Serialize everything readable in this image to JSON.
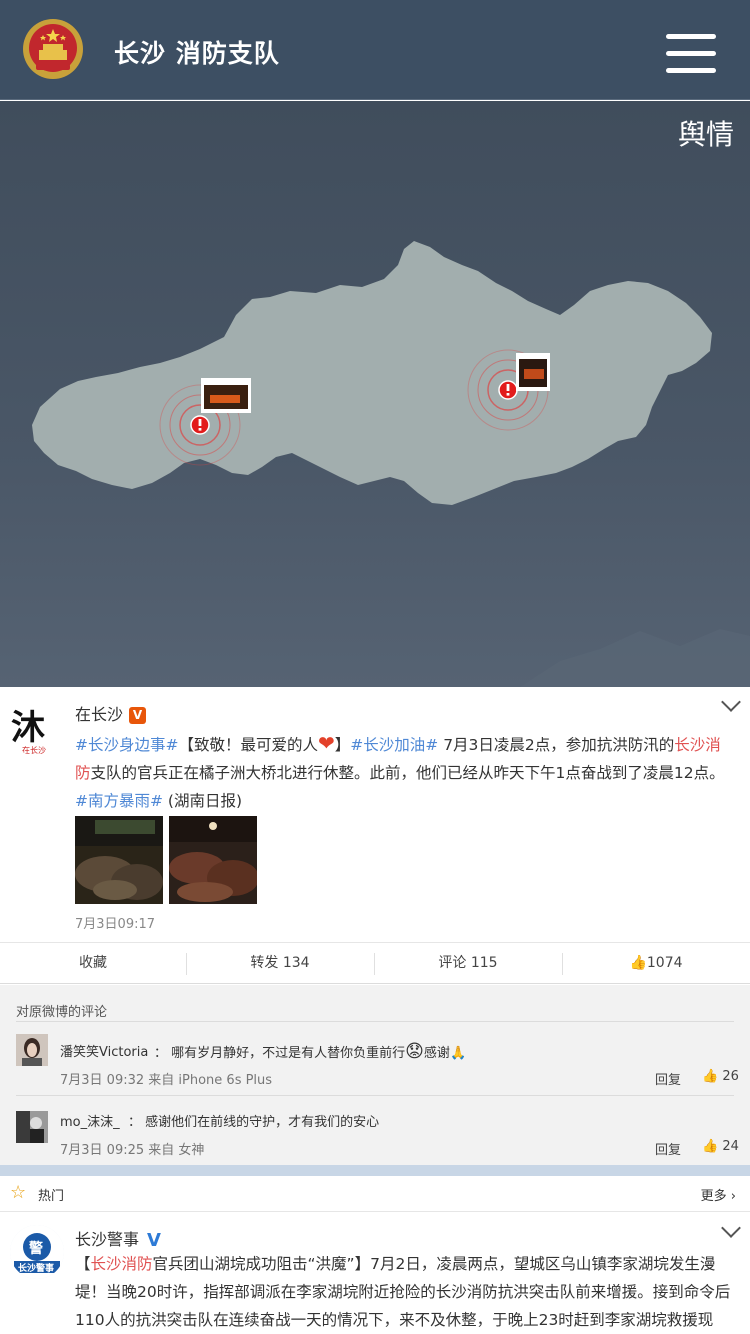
{
  "header": {
    "title": "长沙 消防支队",
    "bg_color": "#3d4f63"
  },
  "map": {
    "label": "舆情",
    "land_color": "#a2aeae"
  },
  "post1": {
    "user": "在长沙",
    "avatar_text": "沐",
    "tag1": "#长沙身边事#",
    "text1": "【致敬！最可爱的人",
    "text2": "】",
    "tag2": "#长沙加油#",
    "text3": " 7月3日凌晨2点，参加抗洪防汛的",
    "red1": "长沙消防",
    "text4": "支队的官兵正在橘子洲大桥北进行休整。此前，他们已经从昨天下午1点奋战到了凌晨12点。",
    "tag3": "#南方暴雨#",
    "text5": " (湖南日报)",
    "time": "7月3日09:17"
  },
  "actions": {
    "collect": "收藏",
    "repost": "转发 134",
    "comment": "评论 115",
    "like": "1074"
  },
  "comments": {
    "header": "对原微博的评论",
    "items": [
      {
        "user": "潘笑笑Victoria",
        "text": "哪有岁月静好，不过是有人替你负重前行",
        "text_after": "感谢",
        "meta": "7月3日 09:32 来自 iPhone 6s Plus",
        "reply": "回复",
        "likes": "26"
      },
      {
        "user": "mo_沫沫_",
        "text": "感谢他们在前线的守护，才有我们的安心",
        "meta": "7月3日 09:25 来自 女神",
        "reply": "回复",
        "likes": "24"
      }
    ]
  },
  "hot": {
    "label": "热门",
    "more": "更多"
  },
  "post2": {
    "user": "长沙警事",
    "red1": "长沙消防",
    "text1": "官兵团山湖垸成功阻击“洪魔”】7月2日，凌晨两点，望城区乌山镇李家湖垸发生漫堤！当晚20时许，指挥部调派在李家湖垸附近抢险的长沙消防抗洪突击队前来增援。接到命令后110人的抗洪突击队在连续奋战一天的情况下，来不及休整，于晚上23时赶到李家湖垸救援现场。经过近"
  }
}
